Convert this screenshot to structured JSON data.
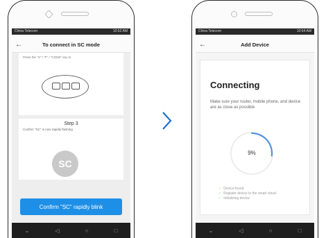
{
  "left_phone": {
    "title": "To connect in SC mode",
    "back_icon": "back-arrow-icon",
    "hint": "Press the \"S\" / \"F\" / \"CODE\" key to",
    "step_label": "Step 3",
    "confirm_text": "Confirm \"SC\" is now rapidly flashing",
    "badge": "SC",
    "confirm_button": "Confirm \"SC\" rapidly blink"
  },
  "right_phone": {
    "title": "Add Device",
    "back_icon": "back-arrow-icon",
    "heading": "Connecting",
    "description": "Make sure your router, mobile phone, and device are as close as possible",
    "progress_value": 9,
    "progress_label": "9%",
    "steps": [
      "Device found",
      "Register device to the smart cloud",
      "Initializing device"
    ]
  },
  "statusbar": {
    "carrier_left": "China Telecom",
    "status_left": "10:52 AM",
    "carrier_right": "China Telecom",
    "status_right": "10:54 AM"
  },
  "colors": {
    "accent": "#1e8fe6",
    "badge": "#c9c9c9",
    "check": "#a8d47a"
  }
}
